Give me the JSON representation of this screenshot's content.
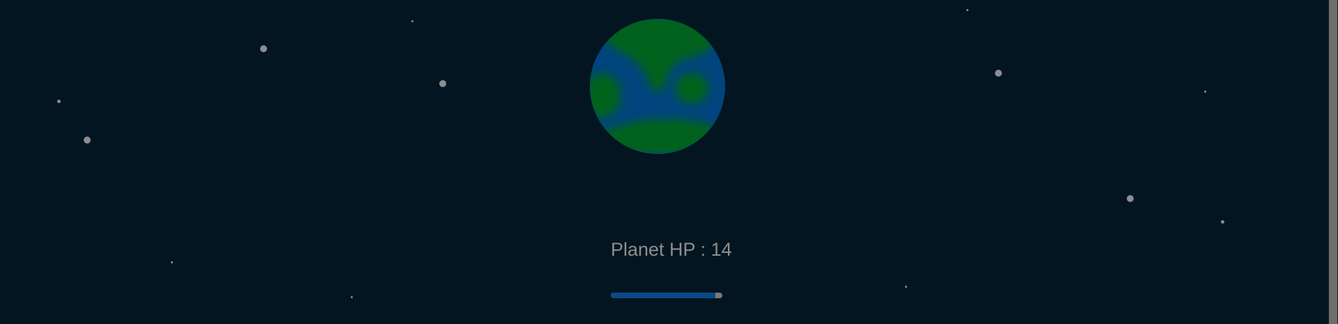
{
  "game": {
    "hp_label": "Planet HP : 14",
    "planet_hp_fraction": 0.94
  },
  "colors": {
    "space_background": "#021520",
    "planet_ocean": "#00457d",
    "planet_land": "#03621f",
    "star": "#8b8d90",
    "hp_text": "#8e8e8e",
    "hp_bar_fill": "#0a4a8a",
    "hp_bar_empty": "#7a7a7a"
  },
  "icons": {
    "planet": "planet-icon",
    "star": "star-icon"
  }
}
